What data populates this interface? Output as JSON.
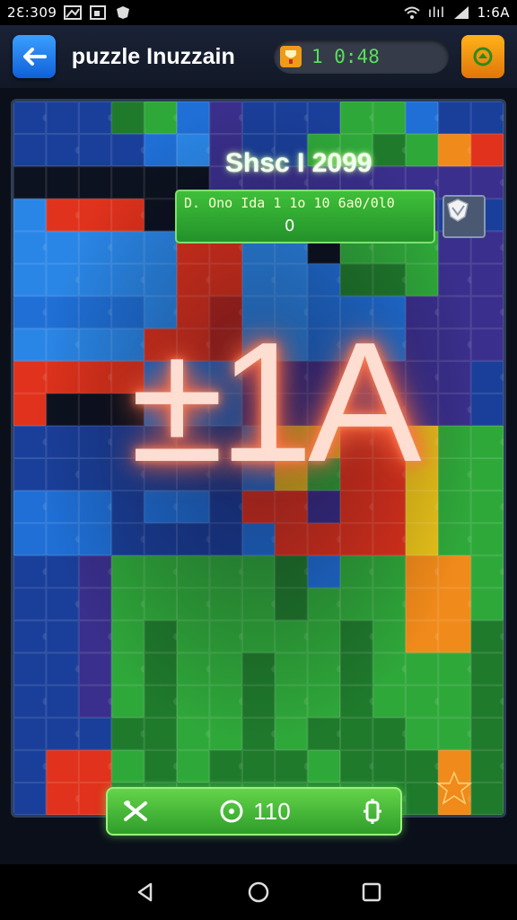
{
  "status_bar": {
    "time_left": "2Ɛ:309",
    "time_right": "1:6A",
    "network_label": "ılıl"
  },
  "header": {
    "title": "puzzle Inuzzain",
    "timer": "1 0:48",
    "back_icon": "arrow-left-icon",
    "cup_icon": "trophy-icon",
    "settings_icon": "flag-icon"
  },
  "board": {
    "score_line": "Shsc I  2099",
    "info_line1": "D. Ono  Ida  1  1o  10  6a0/0l0",
    "info_line2": "0",
    "big_number": "±1A",
    "shield_icon": "shield-icon"
  },
  "action_bar": {
    "moves": "110",
    "left_icon": "scissors-icon",
    "center_icon": "clock-icon",
    "right_icon": "gear-icon"
  },
  "nav_bar": {
    "back_icon": "nav-back-icon",
    "home_icon": "nav-home-icon",
    "recents_icon": "nav-recents-icon"
  },
  "colors": {
    "accent_green": "#3fbf3a",
    "accent_blue": "#1f6fe0",
    "accent_orange": "#f08a1a",
    "glow": "#ff6a4a"
  }
}
